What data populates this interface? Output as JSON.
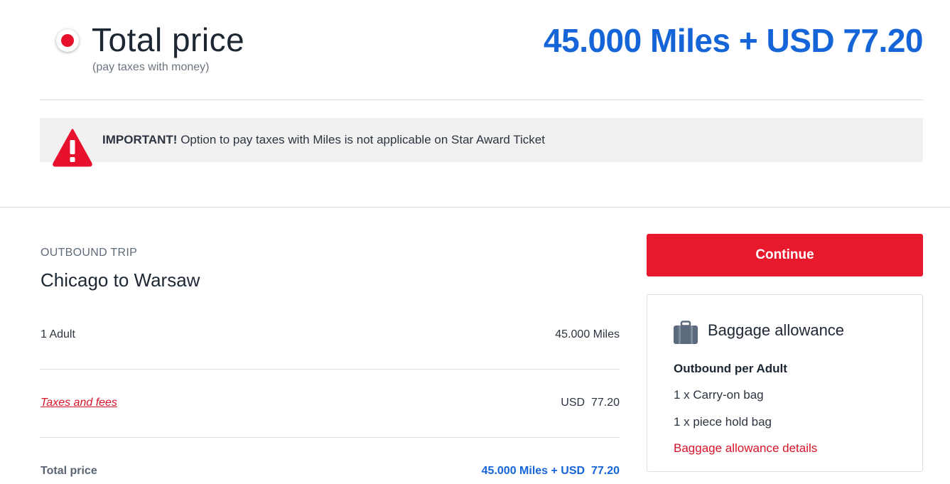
{
  "header": {
    "title": "Total price",
    "subtitle": "(pay taxes with money)",
    "total": "45.000 Miles + USD 77.20"
  },
  "notice": {
    "label": "IMPORTANT!",
    "text": "Option to pay taxes with Miles is not applicable on Star Award Ticket"
  },
  "trip": {
    "label": "OUTBOUND TRIP",
    "route": "Chicago to Warsaw",
    "rows": [
      {
        "label": "1 Adult",
        "value": "45.000 Miles"
      },
      {
        "label": "Taxes and fees",
        "value": "USD  77.20"
      }
    ],
    "total_label": "Total price",
    "total_value": "45.000 Miles + USD  77.20"
  },
  "actions": {
    "continue_label": "Continue"
  },
  "baggage": {
    "title": "Baggage allowance",
    "subtitle": "Outbound per Adult",
    "items": [
      "1 x Carry-on bag",
      "1 x piece hold bag"
    ],
    "link": "Baggage allowance details"
  },
  "colors": {
    "accent_blue": "#1565d8",
    "brand_red": "#e8192c",
    "link_red": "#d9132a"
  },
  "icons": {
    "radio": "radio-selected-icon",
    "warning": "warning-triangle-icon",
    "baggage": "suitcase-icon"
  }
}
